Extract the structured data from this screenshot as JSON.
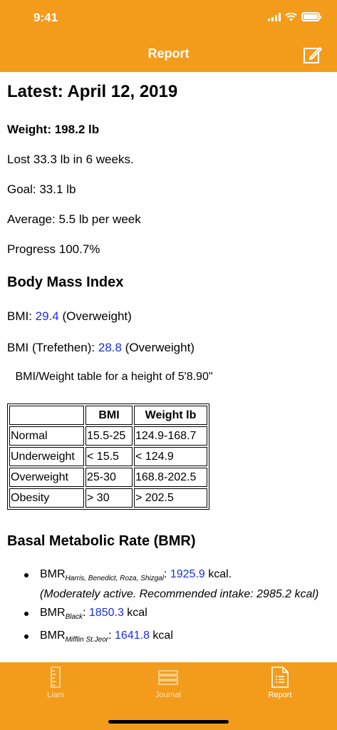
{
  "status": {
    "time": "9:41"
  },
  "nav": {
    "title": "Report",
    "edit_icon": "compose-icon"
  },
  "report": {
    "heading": "Latest: April 12, 2019",
    "weight": "Weight: 198.2 lb",
    "lost": "Lost 33.3 lb in 6 weeks.",
    "goal": "Goal: 33.1 lb",
    "average": "Average: 5.5 lb per week",
    "progress": "Progress 100.7%"
  },
  "bmi": {
    "heading": "Body Mass Index",
    "bmi_label": "BMI: ",
    "bmi_value": "29.4",
    "bmi_class": " (Overweight)",
    "tref_label": "BMI (Trefethen): ",
    "tref_value": "28.8",
    "tref_class": " (Overweight)",
    "table_caption": "BMI/Weight table for a height of 5'8.90\"",
    "headers": [
      "",
      "BMI",
      "Weight lb"
    ],
    "rows": [
      [
        "Normal",
        "15.5-25",
        "124.9-168.7"
      ],
      [
        "Underweight",
        "< 15.5",
        "< 124.9"
      ],
      [
        "Overweight",
        "25-30",
        "168.8-202.5"
      ],
      [
        "Obesity",
        "> 30",
        "> 202.5"
      ]
    ]
  },
  "bmr": {
    "heading": "Basal Metabolic Rate (BMR)",
    "items": [
      {
        "prefix": "BMR",
        "sub": "Harris, Benedict, Roza, Shizgal",
        "sep": ": ",
        "value": "1925.9",
        "unit": " kcal.",
        "note": "(Moderately active. Recommended intake: 2985.2 kcal)"
      },
      {
        "prefix": "BMR",
        "sub": "Black",
        "sep": ": ",
        "value": "1850.3",
        "unit": " kcal"
      },
      {
        "prefix": "BMR",
        "sub": "Mifflin St.Jeor",
        "sep": ": ",
        "value": "1641.8",
        "unit": " kcal"
      }
    ]
  },
  "tabs": [
    {
      "label": "Liam",
      "icon": "ruler-icon"
    },
    {
      "label": "Journal",
      "icon": "list-icon"
    },
    {
      "label": "Report",
      "icon": "document-icon"
    }
  ],
  "colors": {
    "accent": "#f39c1c",
    "link": "#1a2ee0"
  }
}
